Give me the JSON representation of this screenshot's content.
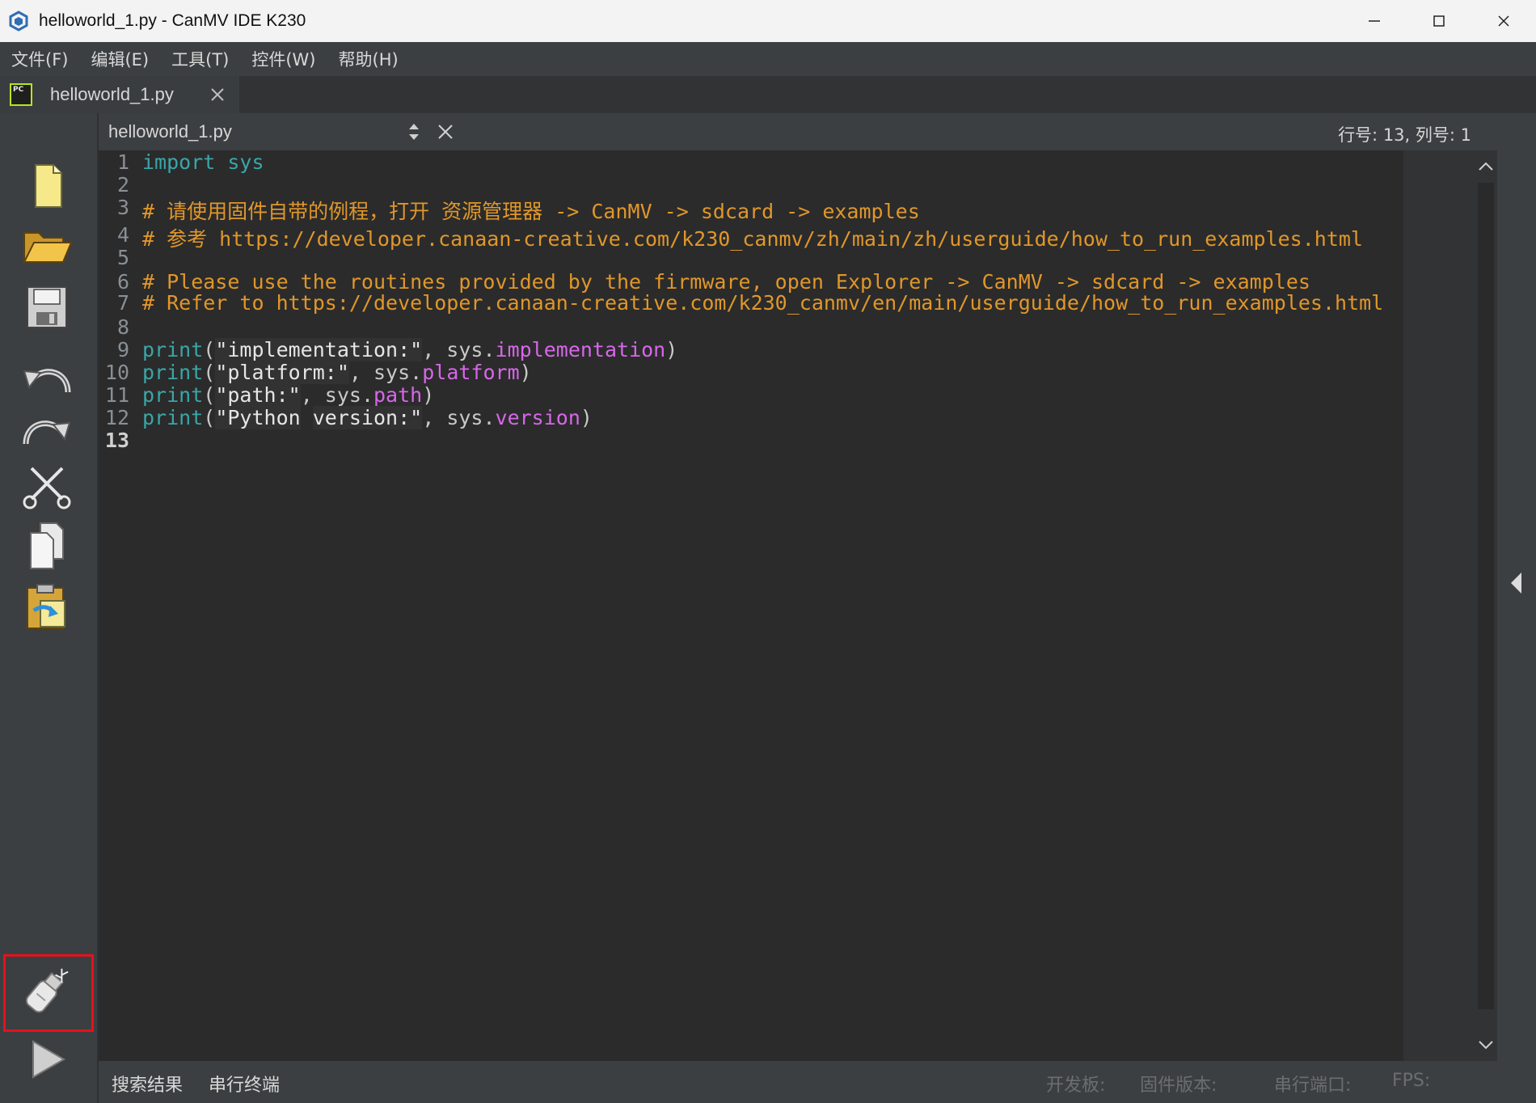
{
  "window": {
    "title": "helloworld_1.py - CanMV IDE K230"
  },
  "menu": [
    "文件(F)",
    "编辑(E)",
    "工具(T)",
    "控件(W)",
    "帮助(H)"
  ],
  "file_tab": {
    "icon_label": "PC",
    "name": "helloworld_1.py"
  },
  "editor": {
    "filename": "helloworld_1.py",
    "cursor_position": "行号: 13, 列号: 1",
    "lines": [
      {
        "n": "1",
        "tokens": [
          {
            "t": "import",
            "c": "kw"
          },
          {
            "t": " ",
            "c": "plain"
          },
          {
            "t": "sys",
            "c": "kw"
          }
        ]
      },
      {
        "n": "2",
        "tokens": []
      },
      {
        "n": "3",
        "tokens": [
          {
            "t": "# 请使用固件自带的例程，打开 资源管理器 -> CanMV -> sdcard -> examples",
            "c": "cm"
          }
        ]
      },
      {
        "n": "4",
        "tokens": [
          {
            "t": "# 参考 https://developer.canaan-creative.com/k230_canmv/zh/main/zh/userguide/how_to_run_examples.html",
            "c": "cm"
          }
        ]
      },
      {
        "n": "5",
        "tokens": []
      },
      {
        "n": "6",
        "tokens": [
          {
            "t": "# Please use the routines provided by the firmware, open Explorer -> CanMV -> sdcard -> examples",
            "c": "cm"
          }
        ]
      },
      {
        "n": "7",
        "tokens": [
          {
            "t": "# Refer to https://developer.canaan-creative.com/k230_canmv/en/main/userguide/how_to_run_examples.html",
            "c": "cm"
          }
        ]
      },
      {
        "n": "8",
        "tokens": []
      },
      {
        "n": "9",
        "tokens": [
          {
            "t": "print",
            "c": "fn"
          },
          {
            "t": "(",
            "c": "plain"
          },
          {
            "t": "\"implementation:\"",
            "c": "str"
          },
          {
            "t": ", sys.",
            "c": "plain"
          },
          {
            "t": "implementation",
            "c": "attr"
          },
          {
            "t": ")",
            "c": "plain"
          }
        ]
      },
      {
        "n": "10",
        "tokens": [
          {
            "t": "print",
            "c": "fn"
          },
          {
            "t": "(",
            "c": "plain"
          },
          {
            "t": "\"platform:\"",
            "c": "str"
          },
          {
            "t": ", sys.",
            "c": "plain"
          },
          {
            "t": "platform",
            "c": "attr"
          },
          {
            "t": ")",
            "c": "plain"
          }
        ]
      },
      {
        "n": "11",
        "tokens": [
          {
            "t": "print",
            "c": "fn"
          },
          {
            "t": "(",
            "c": "plain"
          },
          {
            "t": "\"path:\"",
            "c": "str"
          },
          {
            "t": ", sys.",
            "c": "plain"
          },
          {
            "t": "path",
            "c": "attr"
          },
          {
            "t": ")",
            "c": "plain"
          }
        ]
      },
      {
        "n": "12",
        "tokens": [
          {
            "t": "print",
            "c": "fn"
          },
          {
            "t": "(",
            "c": "plain"
          },
          {
            "t": "\"Python",
            "c": "str"
          },
          {
            "t": " ",
            "c": "plain"
          },
          {
            "t": "version:\"",
            "c": "str"
          },
          {
            "t": ", sys.",
            "c": "plain"
          },
          {
            "t": "version",
            "c": "attr"
          },
          {
            "t": ")",
            "c": "plain"
          }
        ]
      },
      {
        "n": "13",
        "tokens": [],
        "current": true
      }
    ]
  },
  "toolbar": [
    {
      "name": "new-file-icon"
    },
    {
      "name": "open-folder-icon"
    },
    {
      "name": "save-icon"
    },
    {
      "name": "undo-icon"
    },
    {
      "name": "redo-icon"
    },
    {
      "name": "cut-icon"
    },
    {
      "name": "copy-icon"
    },
    {
      "name": "paste-icon"
    }
  ],
  "bottom_tools": [
    {
      "name": "usb-connect-icon",
      "highlighted": true
    },
    {
      "name": "run-icon"
    }
  ],
  "status_bar": {
    "tabs": [
      "搜索结果",
      "串行终端"
    ],
    "board_label": "开发板:",
    "firmware_label": "固件版本:",
    "port_label": "串行端口:",
    "fps_label": "FPS:"
  },
  "colors": {
    "keyword": "#3aa6a8",
    "comment": "#e0972a",
    "attribute": "#d767e9",
    "highlight_frame": "#e8101c"
  }
}
